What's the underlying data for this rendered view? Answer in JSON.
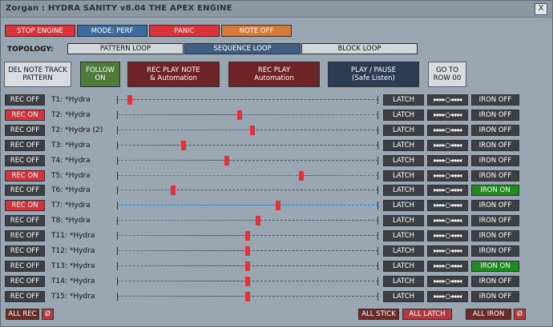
{
  "window": {
    "title": "Zorgan : HYDRA SANITY v8.04 THE APEX ENGINE",
    "close_label": "X"
  },
  "toolbar": {
    "stop_engine": "STOP ENGINE",
    "mode": "MODE: PERF",
    "panic": "PANIC",
    "note_off": "NOTE OFF"
  },
  "topology": {
    "label": "TOPOLOGY:",
    "options": [
      "PATTERN LOOP",
      "SEQUENCE LOOP",
      "BLOCK LOOP"
    ],
    "active": "SEQUENCE LOOP"
  },
  "actions": {
    "del_note_track": [
      "DEL NOTE TRACK",
      "PATTERN"
    ],
    "follow": [
      "FOLLOW",
      "ON"
    ],
    "rec_play_note": [
      "REC PLAY NOTE",
      "& Automation"
    ],
    "rec_play": [
      "REC PLAY",
      "Automation"
    ],
    "play_pause": [
      "PLAY / PAUSE",
      "(Safe Listen)"
    ],
    "goto_row": [
      "GO TO",
      "ROW 00"
    ]
  },
  "colors": {
    "rec_on": "#d1343a",
    "iron_on": "#1f8a1f",
    "slider_active": "#2e7fd9",
    "handle": "#e03238"
  },
  "tracks": [
    {
      "rec": "REC OFF",
      "rec_on": false,
      "label": "T1: *Hydra",
      "level": 0.04,
      "latch": "LATCH",
      "transport": "▸▸▸▸○◂◂◂◂",
      "iron": "IRON OFF",
      "iron_on": false
    },
    {
      "rec": "REC ON",
      "rec_on": true,
      "label": "T2: *Hydra",
      "level": 0.47,
      "latch": "LATCH",
      "transport": "▸▸▸▸○◂◂◂◂",
      "iron": "IRON OFF",
      "iron_on": false
    },
    {
      "rec": "REC OFF",
      "rec_on": false,
      "label": "T2: *Hydra (2)",
      "level": 0.52,
      "latch": "LATCH",
      "transport": "▸▸▸▸○◂◂◂◂",
      "iron": "IRON OFF",
      "iron_on": false
    },
    {
      "rec": "REC OFF",
      "rec_on": false,
      "label": "T3: *Hydra",
      "level": 0.25,
      "latch": "LATCH",
      "transport": "▸▸▸▸○◂◂◂◂",
      "iron": "IRON OFF",
      "iron_on": false
    },
    {
      "rec": "REC OFF",
      "rec_on": false,
      "label": "T4: *Hydra",
      "level": 0.42,
      "latch": "LATCH",
      "transport": "▸▸▸▸○◂◂◂◂",
      "iron": "IRON OFF",
      "iron_on": false
    },
    {
      "rec": "REC ON",
      "rec_on": true,
      "label": "T5: *Hydra",
      "level": 0.71,
      "latch": "LATCH",
      "transport": "▸▸▸▸○◂◂◂◂",
      "iron": "IRON OFF",
      "iron_on": false
    },
    {
      "rec": "REC OFF",
      "rec_on": false,
      "label": "T6: *Hydra",
      "level": 0.21,
      "latch": "LATCH",
      "transport": "▸▸▸▸○◂◂◂◂",
      "iron": "IRON ON",
      "iron_on": true
    },
    {
      "rec": "REC ON",
      "rec_on": true,
      "label": "T7: *Hydra",
      "level": 0.62,
      "latch": "LATCH",
      "transport": "▸▸▸▸○◂◂◂◂",
      "iron": "IRON OFF",
      "iron_on": false
    },
    {
      "rec": "REC OFF",
      "rec_on": false,
      "label": "T8: *Hydra",
      "level": 0.54,
      "latch": "LATCH",
      "transport": "▸▸▸▸○◂◂◂◂",
      "iron": "IRON OFF",
      "iron_on": false
    },
    {
      "rec": "REC OFF",
      "rec_on": false,
      "label": "T11: *Hydra",
      "level": 0.5,
      "latch": "LATCH",
      "transport": "▸▸▸▸○◂◂◂◂",
      "iron": "IRON OFF",
      "iron_on": false
    },
    {
      "rec": "REC OFF",
      "rec_on": false,
      "label": "T12: *Hydra",
      "level": 0.5,
      "latch": "LATCH",
      "transport": "▸▸▸▸○◂◂◂◂",
      "iron": "IRON OFF",
      "iron_on": false
    },
    {
      "rec": "REC OFF",
      "rec_on": false,
      "label": "T13: *Hydra",
      "level": 0.5,
      "latch": "LATCH",
      "transport": "▸▸▸▸○◂◂◂◂",
      "iron": "IRON ON",
      "iron_on": true
    },
    {
      "rec": "REC OFF",
      "rec_on": false,
      "label": "T14: *Hydra",
      "level": 0.5,
      "latch": "LATCH",
      "transport": "▸▸▸▸○◂◂◂◂",
      "iron": "IRON OFF",
      "iron_on": false
    },
    {
      "rec": "REC OFF",
      "rec_on": false,
      "label": "T15: *Hydra",
      "level": 0.5,
      "latch": "LATCH",
      "transport": "▸▸▸▸○◂◂◂◂",
      "iron": "IRON OFF",
      "iron_on": false
    }
  ],
  "footer": {
    "all_rec": "ALL REC",
    "null1": "Ø",
    "all_stick": "ALL STICK",
    "all_latch": "ALL LATCH",
    "all_iron": "ALL IRON",
    "null2": "Ø"
  }
}
